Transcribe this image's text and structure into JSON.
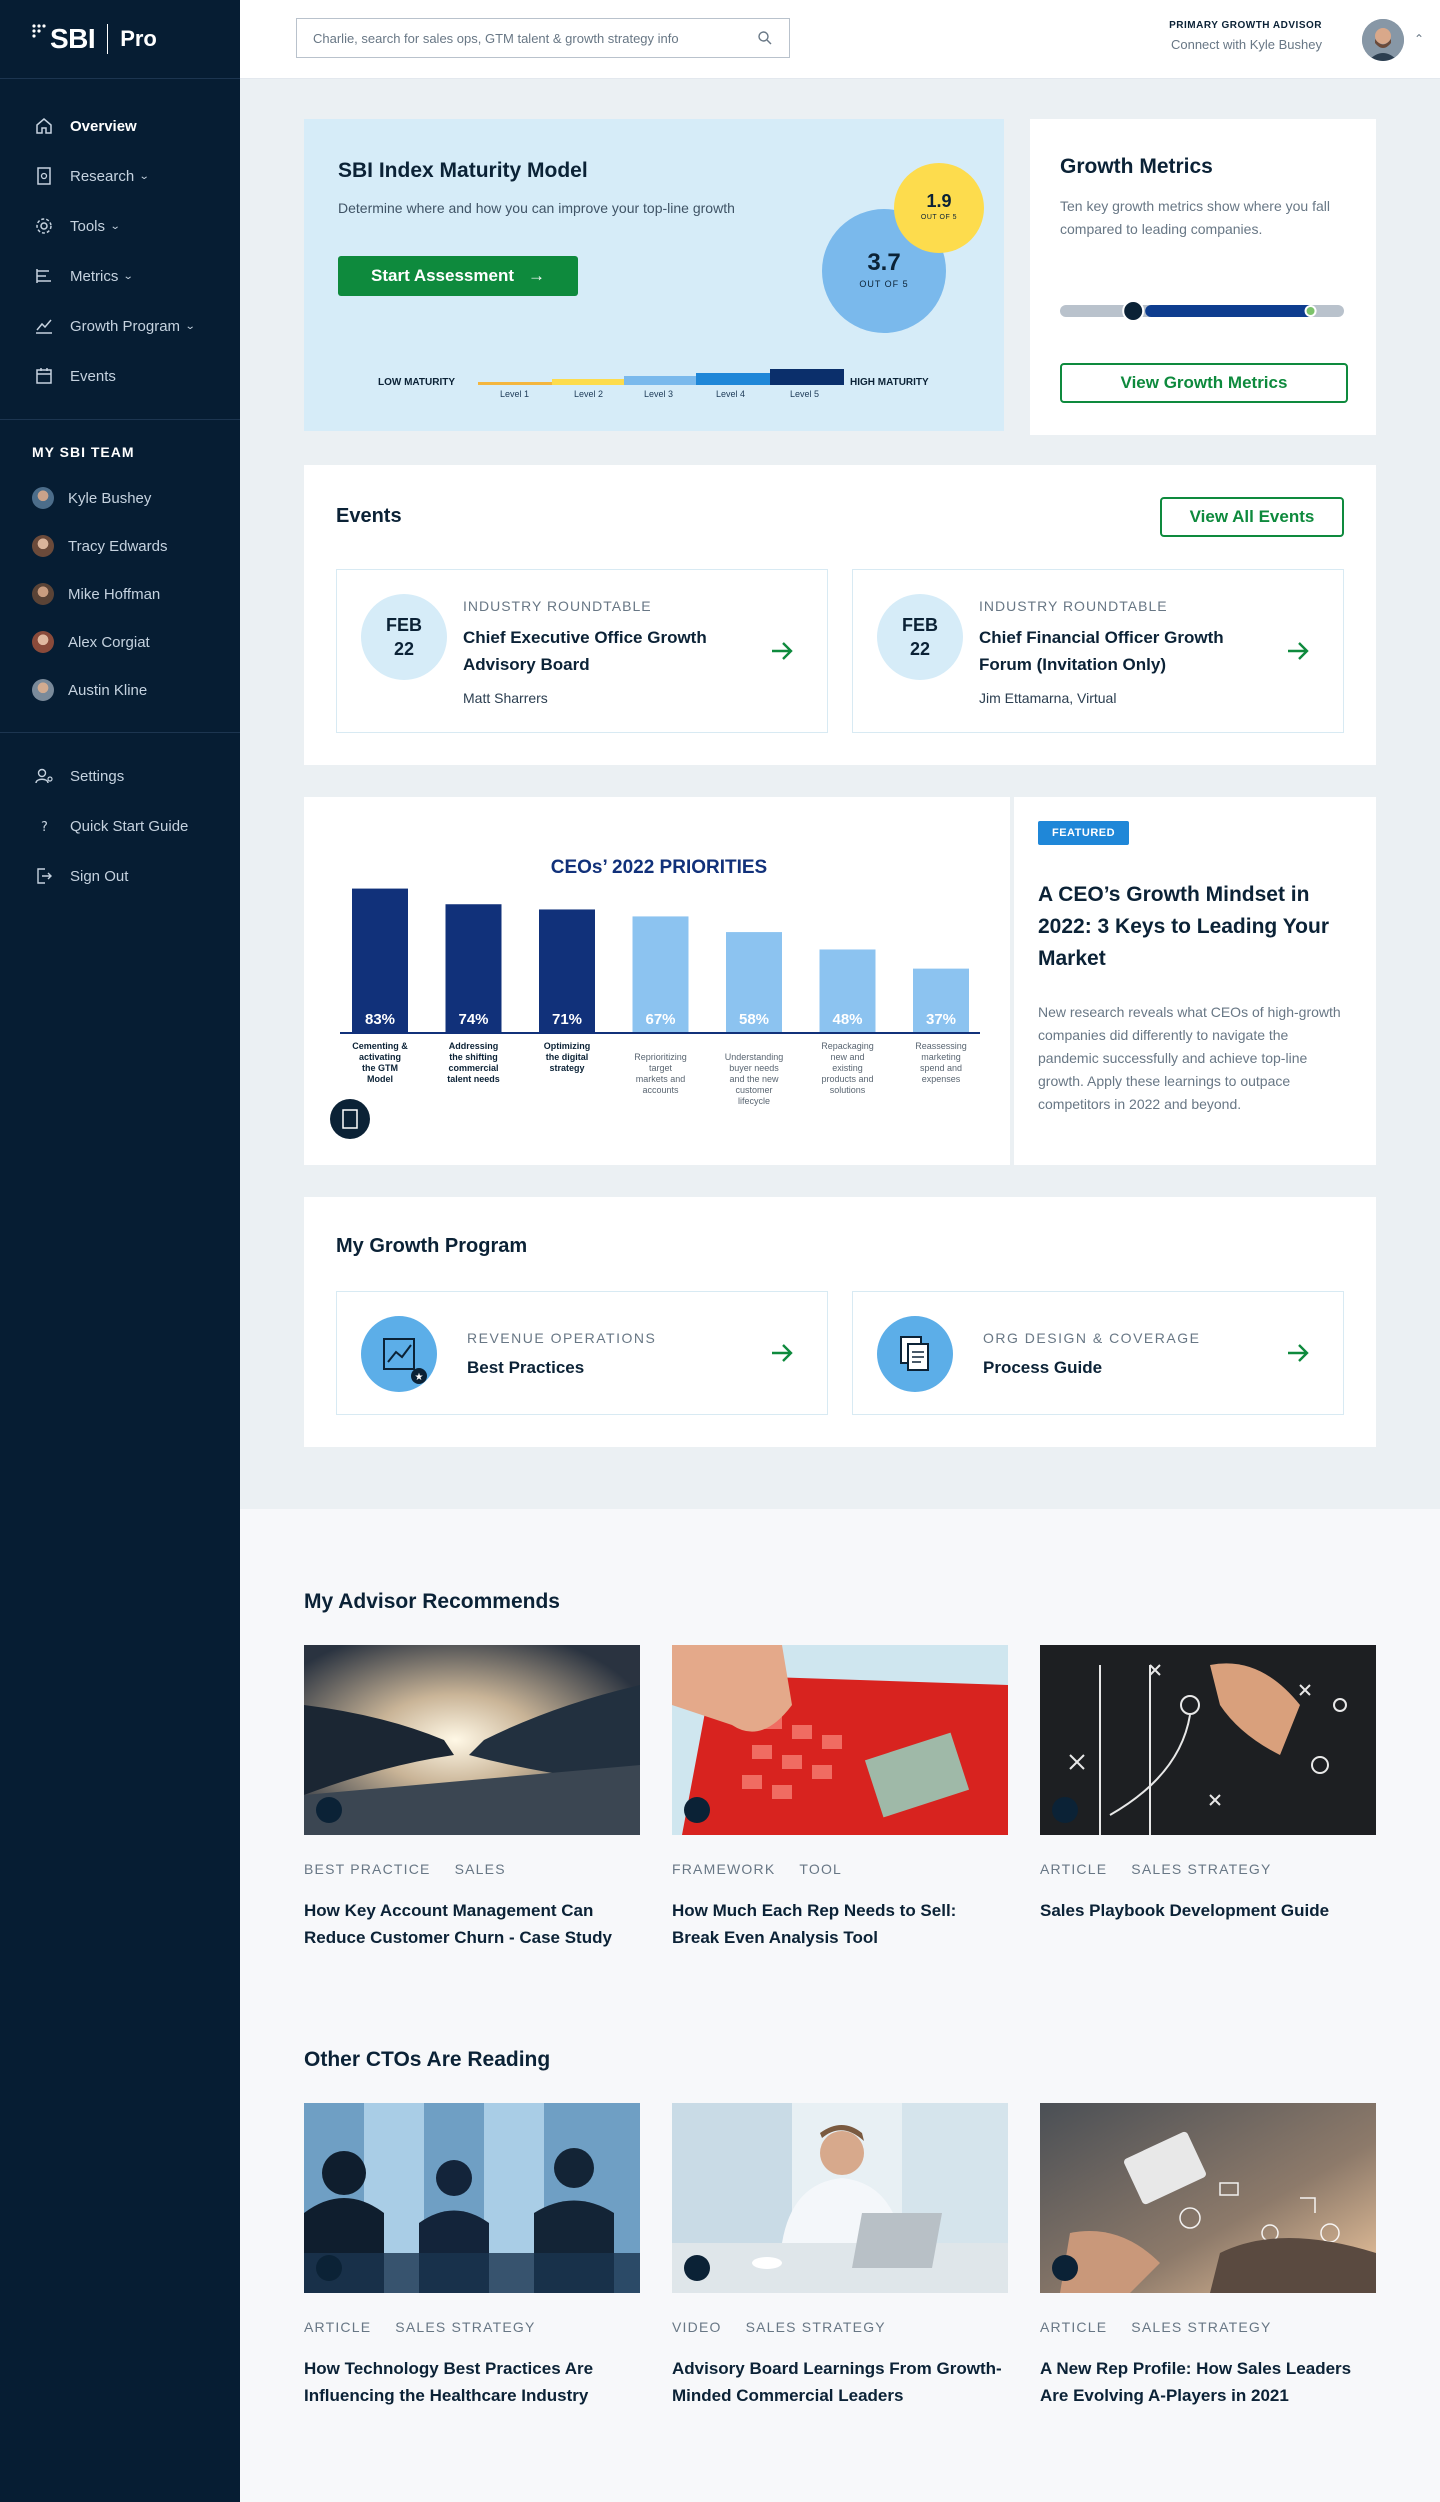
{
  "brand": {
    "logo_text": "SBI",
    "product": "Pro"
  },
  "sidebar": {
    "nav": [
      {
        "label": "Overview",
        "icon": "home-icon"
      },
      {
        "label": "Research",
        "icon": "document-icon"
      },
      {
        "label": "Tools",
        "icon": "gear-icon"
      },
      {
        "label": "Metrics",
        "icon": "bar-chart-icon"
      },
      {
        "label": "Growth Program",
        "icon": "trend-icon"
      },
      {
        "label": "Events",
        "icon": "calendar-icon"
      }
    ],
    "team_heading": "MY SBI TEAM",
    "team": [
      "Kyle Bushey",
      "Tracy Edwards",
      "Mike Hoffman",
      "Alex Corgiat",
      "Austin Kline"
    ],
    "utility": [
      {
        "label": "Settings",
        "icon": "user-settings-icon"
      },
      {
        "label": "Quick Start Guide",
        "icon": "question-icon"
      },
      {
        "label": "Sign Out",
        "icon": "sign-out-icon"
      }
    ]
  },
  "header": {
    "search_placeholder": "Charlie, search for sales ops, GTM talent & growth strategy info",
    "advisor_label": "PRIMARY GROWTH ADVISOR",
    "advisor_sub": "Connect with Kyle Bushey"
  },
  "maturity": {
    "title": "SBI Index Maturity Model",
    "description": "Determine where and how you can improve your top-line growth",
    "button": "Start Assessment",
    "score": "3.7",
    "score_sub": "OUT OF 5",
    "benchmark": "1.9",
    "benchmark_sub": "OUT OF 5",
    "low_label": "LOW MATURITY",
    "high_label": "HIGH MATURITY",
    "levels": [
      "Level 1",
      "Level 2",
      "Level 3",
      "Level 4",
      "Level 5"
    ],
    "level_colors": [
      "#f4b63f",
      "#fddc4d",
      "#7ab9ec",
      "#1f87d8",
      "#0b2f6b"
    ]
  },
  "growth_metrics": {
    "title": "Growth Metrics",
    "description": "Ten key growth metrics show where you fall compared to leading companies.",
    "button": "View Growth Metrics",
    "range_start": 0.3,
    "range_end": 0.84
  },
  "events": {
    "title": "Events",
    "button": "View All Events",
    "items": [
      {
        "month": "FEB",
        "day": "22",
        "category": "INDUSTRY ROUNDTABLE",
        "title": "Chief Executive Office Growth Advisory Board",
        "host": "Matt Sharrers"
      },
      {
        "month": "FEB",
        "day": "22",
        "category": "INDUSTRY ROUNDTABLE",
        "title": "Chief Financial Officer Growth Forum (Invitation Only)",
        "host": "Jim Ettamarna, Virtual"
      }
    ]
  },
  "chart_data": {
    "type": "bar",
    "title": "CEOs’ 2022 PRIORITIES",
    "categories": [
      "Cementing & activating the GTM Model",
      "Addressing the shifting commercial talent needs",
      "Optimizing the digital strategy",
      "Reprioritizing target markets and accounts",
      "Understanding buyer needs and the new customer lifecycle",
      "Repackaging new and existing products and solutions",
      "Reassessing marketing spend and expenses"
    ],
    "values": [
      83,
      74,
      71,
      67,
      58,
      48,
      37
    ],
    "value_labels": [
      "83%",
      "74%",
      "71%",
      "67%",
      "58%",
      "48%",
      "37%"
    ],
    "bar_colors": [
      "#11317a",
      "#11317a",
      "#11317a",
      "#8cc3f0",
      "#8cc3f0",
      "#8cc3f0",
      "#8cc3f0"
    ],
    "ylim": [
      0,
      100
    ]
  },
  "featured": {
    "badge": "FEATURED",
    "title": "A CEO’s Growth Mindset in 2022: 3 Keys to Leading Your Market",
    "description": "New research reveals what CEOs of high-growth companies did differently to navigate the pandemic successfully and achieve top-line growth. Apply these learnings to outpace competitors in 2022 and beyond."
  },
  "growth_program": {
    "title": "My Growth Program",
    "items": [
      {
        "category": "REVENUE OPERATIONS",
        "title": "Best Practices",
        "icon": "growth-chart-icon"
      },
      {
        "category": "ORG DESIGN & COVERAGE",
        "title": "Process Guide",
        "icon": "documents-icon"
      }
    ]
  },
  "advisor_recs": {
    "title": "My Advisor Recommends",
    "items": [
      {
        "tags": [
          "BEST PRACTICE",
          "SALES"
        ],
        "title": "How Key Account Management Can Reduce Customer Churn - Case Study",
        "image": "handshake-image"
      },
      {
        "tags": [
          "FRAMEWORK",
          "TOOL"
        ],
        "title": "How Much Each Rep Needs to Sell: Break Even Analysis Tool",
        "image": "calculator-image"
      },
      {
        "tags": [
          "ARTICLE",
          "SALES STRATEGY"
        ],
        "title": "Sales Playbook Development Guide",
        "image": "chalkboard-image"
      }
    ]
  },
  "cto_reading": {
    "title": "Other CTOs Are Reading",
    "items": [
      {
        "tags": [
          "ARTICLE",
          "SALES STRATEGY"
        ],
        "title": "How Technology Best Practices Are Influencing the Healthcare Industry",
        "image": "meeting-image"
      },
      {
        "tags": [
          "VIDEO",
          "SALES STRATEGY"
        ],
        "title": "Advisory Board Learnings From Growth-Minded Commercial Leaders",
        "image": "laptop-man-image"
      },
      {
        "tags": [
          "ARTICLE",
          "SALES STRATEGY"
        ],
        "title": "A New Rep Profile: How Sales Leaders Are Evolving A-Players in 2021",
        "image": "tablet-hands-image"
      }
    ]
  }
}
